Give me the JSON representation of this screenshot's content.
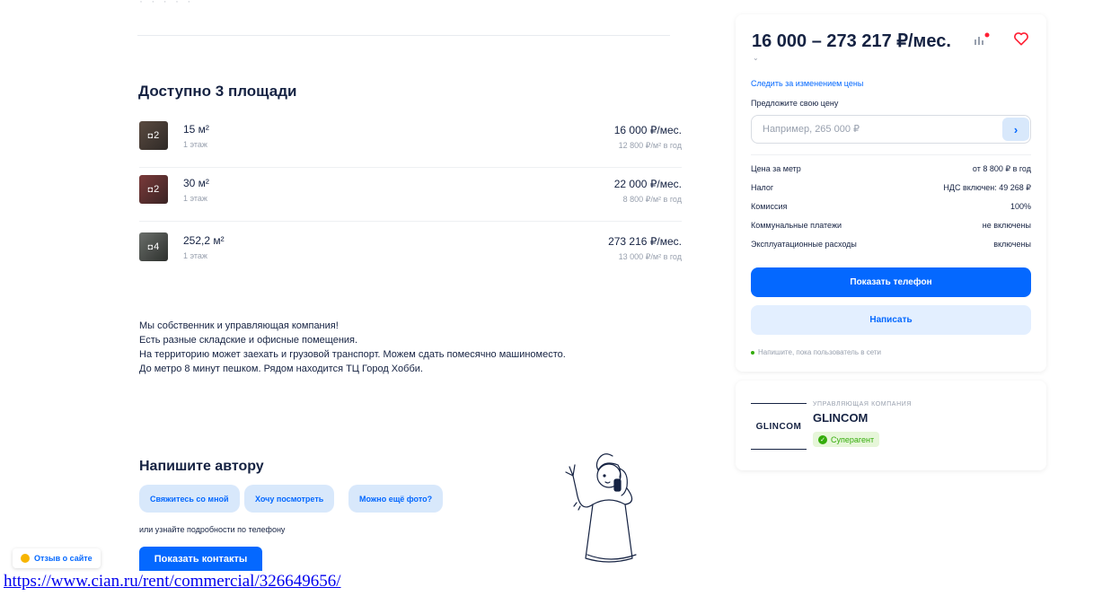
{
  "areas": {
    "title": "Доступно 3 площади",
    "items": [
      {
        "photos": "2",
        "size": "15 м²",
        "floor": "1 этаж",
        "price": "16 000 ₽/мес.",
        "per_year": "12 800 ₽/м² в год"
      },
      {
        "photos": "2",
        "size": "30 м²",
        "floor": "1 этаж",
        "price": "22 000 ₽/мес.",
        "per_year": "8 800 ₽/м² в год"
      },
      {
        "photos": "4",
        "size": "252,2 м²",
        "floor": "1 этаж",
        "price": "273 216 ₽/мес.",
        "per_year": "13 000 ₽/м² в год"
      }
    ]
  },
  "description": {
    "lines": [
      "Мы собственник и управляющая компания!",
      "Есть разные складские и офисные помещения.",
      "На территорию может заехать и грузовой транспорт. Можем сдать помесячно машиноместо.",
      "До метро 8 минут пешком. Рядом находится ТЦ Город Хобби."
    ]
  },
  "write_author": {
    "title": "Напишите автору",
    "chips": [
      "Свяжитесь со мной",
      "Хочу посмотреть",
      "Можно ещё фото?"
    ],
    "phone_hint": "или узнайте подробности по телефону",
    "contacts_button": "Показать контакты"
  },
  "feedback": {
    "label": "Отзыв о сайте"
  },
  "url": "https://www.cian.ru/rent/commercial/326649656/",
  "price_card": {
    "price": "16 000 – 273 217 ₽/мес.",
    "track_link": "Следить за изменением цены",
    "offer_label": "Предложите свою цену",
    "offer_placeholder": "Например, 265 000 ₽",
    "params": [
      {
        "key": "Цена за метр",
        "value": "от 8 800 ₽ в год"
      },
      {
        "key": "Налог",
        "value": "НДС включен: 49 268 ₽"
      },
      {
        "key": "Комиссия",
        "value": "100%"
      },
      {
        "key": "Коммунальные платежи",
        "value": "не включены"
      },
      {
        "key": "Эксплуатационные расходы",
        "value": "включены"
      }
    ],
    "phone_button": "Показать телефон",
    "write_button": "Написать",
    "online_note": "Напишите, пока пользователь в сети",
    "accent_color": "#0468ff"
  },
  "agent": {
    "logo_text": "GLINCOM",
    "type": "УПРАВЛЯЮЩАЯ КОМПАНИЯ",
    "name": "GLINCOM",
    "badge": "Суперагент"
  },
  "icons": [
    "camera-icon",
    "chart-icon",
    "heart-icon",
    "chevron-down-icon",
    "arrow-right-icon",
    "superagent-icon",
    "smile-icon"
  ]
}
